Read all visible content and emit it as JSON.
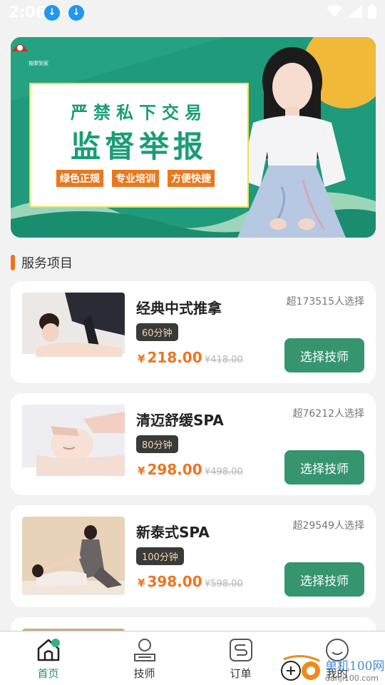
{
  "status_bar": {
    "time": "2:06"
  },
  "banner": {
    "logo_text": "按摩到家",
    "line1": "严禁私下交易",
    "line2": "监督举报",
    "tags": [
      "绿色正规",
      "专业培训",
      "方便快捷"
    ]
  },
  "section": {
    "title": "服务项目"
  },
  "services": [
    {
      "title": "经典中式推拿",
      "count": "超173515人选择",
      "duration": "60分钟",
      "currency": "¥",
      "price": "218.00",
      "original": "¥418.00",
      "button": "选择技师"
    },
    {
      "title": "清迈舒缓SPA",
      "count": "超76212人选择",
      "duration": "80分钟",
      "currency": "¥",
      "price": "298.00",
      "original": "¥498.00",
      "button": "选择技师"
    },
    {
      "title": "新泰式SPA",
      "count": "超29549人选择",
      "duration": "100分钟",
      "currency": "¥",
      "price": "398.00",
      "original": "¥598.00",
      "button": "选择技师"
    }
  ],
  "nav": [
    {
      "label": "首页",
      "icon": "home-icon",
      "active": true
    },
    {
      "label": "技师",
      "icon": "therapist-icon",
      "active": false
    },
    {
      "label": "订单",
      "icon": "order-icon",
      "active": false
    },
    {
      "label": "我的",
      "icon": "profile-icon",
      "active": false
    }
  ],
  "watermark": {
    "site": "单机100网",
    "url": "danji100.com"
  },
  "colors": {
    "accent": "#36946f",
    "price": "#f0741f",
    "banner": "#1f9a7b"
  }
}
